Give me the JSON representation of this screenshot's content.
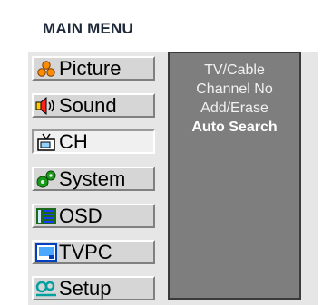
{
  "title": "MAIN MENU",
  "menu_items": [
    {
      "label": "Picture",
      "icon": "people-icon"
    },
    {
      "label": "Sound",
      "icon": "speaker-icon"
    },
    {
      "label": "CH",
      "icon": "tv-antenna-icon"
    },
    {
      "label": "System",
      "icon": "gears-icon"
    },
    {
      "label": "OSD",
      "icon": "list-icon"
    },
    {
      "label": "TVPC",
      "icon": "monitor-icon"
    },
    {
      "label": "Setup",
      "icon": "key-icon"
    }
  ],
  "active_item": "CH",
  "submenu": [
    "TV/Cable",
    "Channel No",
    "Add/Erase",
    "Auto Search"
  ],
  "selected_submenu": "Auto Search",
  "colors": {
    "accent": "#ff8c00",
    "submenu_bg": "#7e7e7e",
    "panel_bg": "#e6e6e6"
  }
}
